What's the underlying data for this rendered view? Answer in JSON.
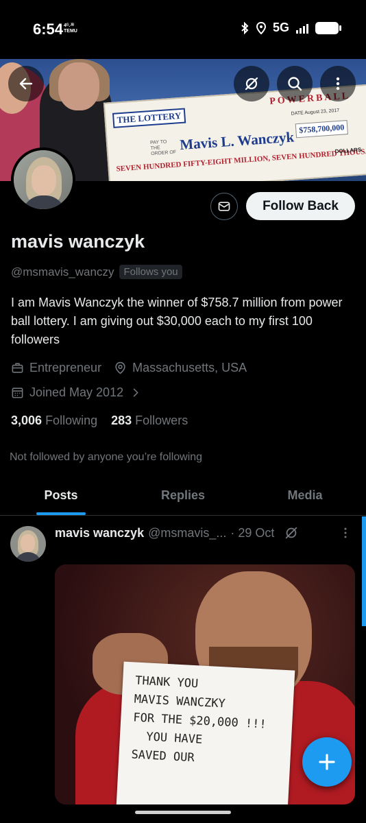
{
  "status_bar": {
    "time": "6:54",
    "network_tag_line1": "4ᴳ.ᴶᴮ",
    "network_tag_line2": "TEMU",
    "network": "5G"
  },
  "banner": {
    "check": {
      "logo": "THE LOTTERY",
      "payto": "PAY TO THE ORDER OF",
      "name": "Mavis L. Wanczyk",
      "amount": "$758,700,000",
      "powerball": "POWERBALL",
      "words": "SEVEN HUNDRED FIFTY-EIGHT MILLION, SEVEN HUNDRED THOUSAND!!",
      "dollars": "DOLLARS",
      "date": "DATE August 23, 2017"
    }
  },
  "header": {
    "back_icon": "arrow-left-icon",
    "grok_icon": "grok-icon",
    "search_icon": "search-icon",
    "more_icon": "more-vertical-icon"
  },
  "profile": {
    "follow_button_label": "Follow Back",
    "display_name": "mavis wanczyk",
    "handle": "@msmavis_wanczy",
    "follows_you": "Follows you",
    "bio": "I am Mavis Wanczyk the winner of $758.7 million from power ball lottery. I am giving out $30,000 each to my first 100 followers",
    "profession": "Entrepreneur",
    "location": "Massachusetts, USA",
    "joined": "Joined May 2012",
    "following_count": "3,006",
    "following_label": "Following",
    "followers_count": "283",
    "followers_label": "Followers",
    "not_followed_text": "Not followed by anyone you’re following"
  },
  "tabs": [
    {
      "label": "Posts",
      "active": true
    },
    {
      "label": "Replies",
      "active": false
    },
    {
      "label": "Media",
      "active": false
    }
  ],
  "post": {
    "author_name": "mavis wanczyk",
    "author_handle": "@msmavis_...",
    "time": "· 29 Oct",
    "sign_text": "THANK YOU\nMAVIS WANCZKY\nFOR THE $20,000 !!!\n  YOU HAVE\nSAVED OUR"
  },
  "colors": {
    "accent": "#1d9bf0",
    "background": "#000000",
    "text_primary": "#e7e9ea",
    "text_secondary": "#71767b"
  }
}
